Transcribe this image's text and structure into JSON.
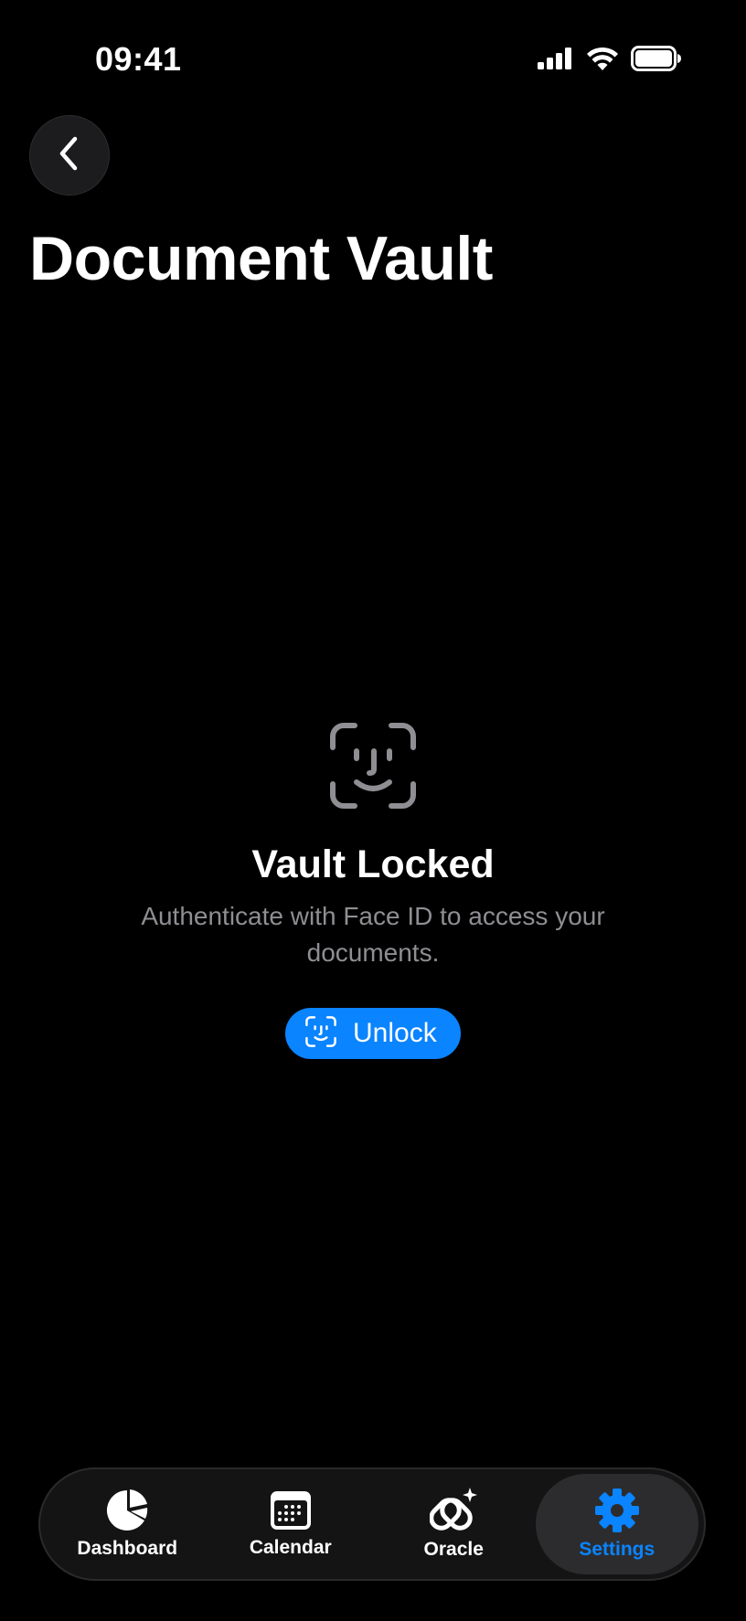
{
  "status_bar": {
    "time": "09:41",
    "icons": [
      "cellular-signal-icon",
      "wifi-icon",
      "battery-icon"
    ]
  },
  "header": {
    "back_icon": "chevron-left-icon",
    "title": "Document Vault"
  },
  "locked_state": {
    "icon": "face-id-icon",
    "title": "Vault Locked",
    "message": "Authenticate with Face ID to access your documents.",
    "unlock_button": {
      "icon": "face-id-icon",
      "label": "Unlock"
    }
  },
  "tab_bar": {
    "tabs": [
      {
        "label": "Dashboard",
        "icon": "pie-chart-icon",
        "active": false
      },
      {
        "label": "Calendar",
        "icon": "calendar-icon",
        "active": false
      },
      {
        "label": "Oracle",
        "icon": "sparkle-link-icon",
        "active": false
      },
      {
        "label": "Settings",
        "icon": "gear-icon",
        "active": true
      }
    ]
  },
  "colors": {
    "background": "#000000",
    "accent": "#0a84ff",
    "secondary_text": "#8e8e93",
    "icon_gray": "#8e8e93"
  }
}
